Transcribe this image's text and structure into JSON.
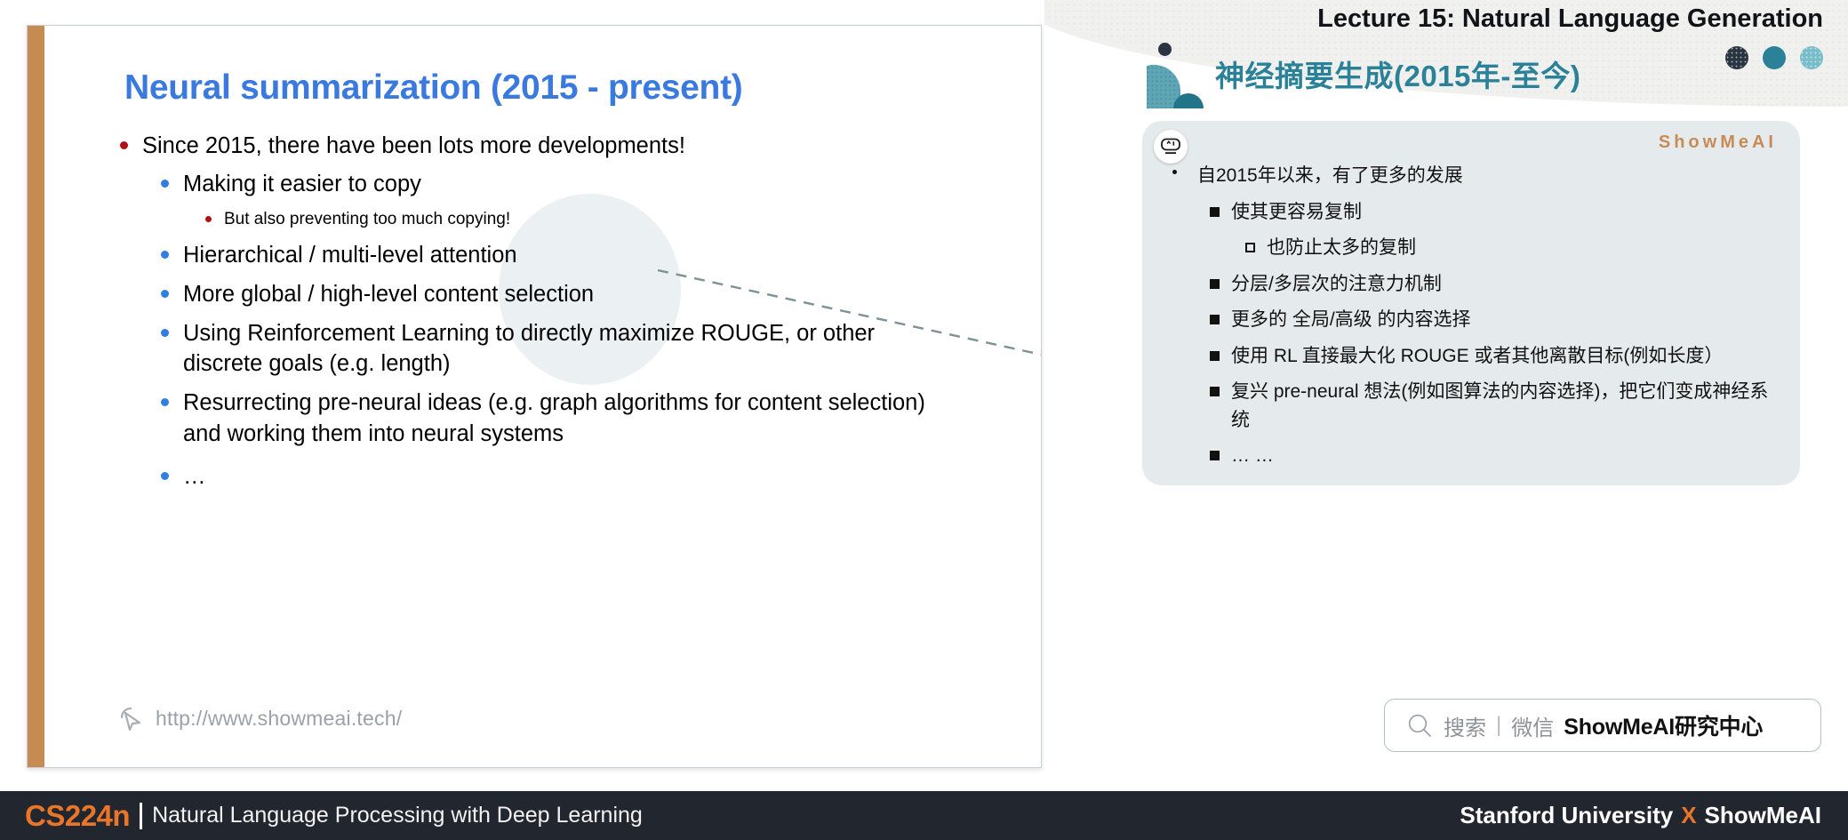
{
  "slide": {
    "title": "Neural summarization (2015 - present)",
    "bullets": [
      {
        "level": 1,
        "text": "Since 2015, there have been lots more developments!"
      },
      {
        "level": 2,
        "text": "Making it easier to copy"
      },
      {
        "level": 3,
        "text": "But also preventing too much copying!"
      },
      {
        "level": 2,
        "text": "Hierarchical / multi-level attention"
      },
      {
        "level": 2,
        "text": "More global / high-level content selection"
      },
      {
        "level": 2,
        "text": "Using Reinforcement Learning to directly maximize ROUGE, or other discrete goals (e.g. length)"
      },
      {
        "level": 2,
        "text": "Resurrecting pre-neural ideas (e.g. graph algorithms for content selection) and working them into neural systems"
      },
      {
        "level": 2,
        "text": "…"
      }
    ],
    "url": "http://www.showmeai.tech/",
    "cursor_icon": "cursor-pointer-icon"
  },
  "right": {
    "lecture_title": "Lecture 15: Natural Language Generation",
    "zh_title": "神经摘要生成(2015年-至今)",
    "card_brand": "ShowMeAI",
    "bot_icon": "robot-face-icon",
    "zh_bullets": [
      {
        "level": 1,
        "text": "自2015年以来，有了更多的发展"
      },
      {
        "level": 2,
        "text": "使其更容易复制"
      },
      {
        "level": 3,
        "text": "也防止太多的复制"
      },
      {
        "level": 2,
        "text": "分层/多层次的注意力机制"
      },
      {
        "level": 2,
        "text": "更多的 全局/高级 的内容选择"
      },
      {
        "level": 2,
        "text": "使用 RL 直接最大化 ROUGE 或者其他离散目标(例如长度）"
      },
      {
        "level": 2,
        "text": "复兴 pre-neural 想法(例如图算法的内容选择)，把它们变成神经系统"
      },
      {
        "level": 2,
        "text": "… …"
      }
    ],
    "search": {
      "icon": "search-icon",
      "label": "搜索",
      "separator": "|",
      "channel": "微信",
      "brand": "ShowMeAI研究中心"
    }
  },
  "bottom_bar": {
    "course_code": "CS224n",
    "course_name": "Natural Language Processing with Deep Learning",
    "org": "Stanford University",
    "x": "X",
    "partner": "ShowMeAI"
  },
  "colors": {
    "title_blue": "#3a79dd",
    "accent_bar": "#c68b52",
    "teal": "#2a8198",
    "orange": "#e8762a",
    "card_bg": "#e5ebec",
    "bar_bg": "#22262e"
  }
}
